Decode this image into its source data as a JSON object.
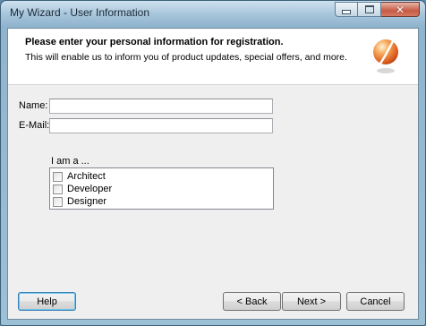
{
  "window": {
    "title": "My Wizard - User Information",
    "controls": {
      "minimize": "minimize",
      "maximize": "maximize",
      "close": "✕"
    }
  },
  "header": {
    "title": "Please enter your personal information for registration.",
    "subtitle": "This will enable us to inform you of product updates, special offers, and more."
  },
  "form": {
    "name_label": "Name:",
    "name_value": "",
    "email_label": "E-Mail:",
    "email_value": "",
    "role_group_label": "I am a ...",
    "roles": [
      {
        "label": "Architect",
        "checked": false
      },
      {
        "label": "Developer",
        "checked": false
      },
      {
        "label": "Designer",
        "checked": false
      }
    ]
  },
  "buttons": {
    "help": "Help",
    "back": "< Back",
    "next": "Next >",
    "cancel": "Cancel"
  },
  "colors": {
    "accent_focus": "#3c7fb1",
    "logo_orange": "#e8742a"
  }
}
